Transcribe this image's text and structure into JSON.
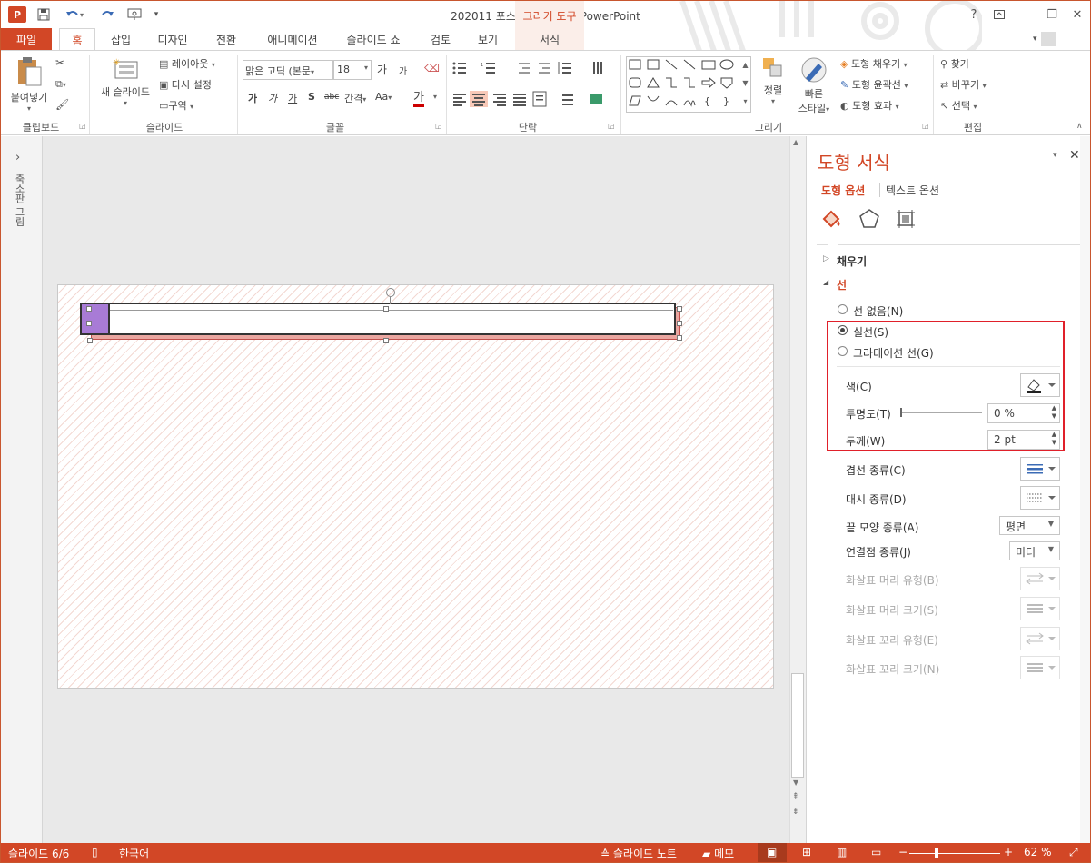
{
  "window": {
    "title": "202011 포스팅용 완성본 - PowerPoint",
    "contextual_group": "그리기 도구",
    "help": "?",
    "minimize": "—",
    "restore": "❐",
    "close": "✕"
  },
  "qat": {
    "logo": "P",
    "save_icon": "save-icon",
    "undo_icon": "undo-icon",
    "redo_icon": "redo-icon"
  },
  "tabs": [
    "파일",
    "홈",
    "삽입",
    "디자인",
    "전환",
    "애니메이션",
    "슬라이드 쇼",
    "검토",
    "보기",
    "서식"
  ],
  "ribbon": {
    "clipboard": {
      "paste": "붙여넣기",
      "label": "클립보드"
    },
    "slides": {
      "new_slide": "새 슬라이드",
      "layout": "레이아웃",
      "reset": "다시 설정",
      "section": "구역",
      "label": "슬라이드"
    },
    "font": {
      "font_name": "맑은 고딕 (본문",
      "font_size": "18",
      "label": "글꼴",
      "grow": "가",
      "shrink": "가",
      "bold": "가",
      "italic": "가",
      "underline": "가",
      "shadow": "S",
      "strike": "abc",
      "spacing": "간격",
      "case": "Aa",
      "color": "가"
    },
    "paragraph": {
      "label": "단락"
    },
    "drawing": {
      "arrange": "정렬",
      "quick_styles_1": "빠른",
      "quick_styles_2": "스타일",
      "fill": "도형 채우기",
      "outline": "도형 윤곽선",
      "effects": "도형 효과",
      "label": "그리기"
    },
    "editing": {
      "find": "찾기",
      "replace": "바꾸기",
      "select": "선택",
      "label": "편집"
    }
  },
  "thumb_panel": {
    "label": "축소판 그림",
    "expand": "›"
  },
  "pane": {
    "title": "도형 서식",
    "tab_shape": "도형 옵션",
    "tab_text": "텍스트 옵션",
    "fill_section": "채우기",
    "line_section": "선",
    "no_line": "선 없음(N)",
    "solid_line": "실선(S)",
    "gradient_line": "그라데이션 선(G)",
    "color": "색(C)",
    "transparency": "투명도(T)",
    "transparency_value": "0 %",
    "width": "두께(W)",
    "width_value": "2 pt",
    "compound": "겹선 종류(C)",
    "dash": "대시 종류(D)",
    "cap": "끝 모양 종류(A)",
    "cap_value": "평면",
    "join": "연결점 종류(J)",
    "join_value": "미터",
    "begin_arrow_type": "화살표 머리 유형(B)",
    "begin_arrow_size": "화살표 머리 크기(S)",
    "end_arrow_type": "화살표 꼬리 유형(E)",
    "end_arrow_size": "화살표 꼬리 크기(N)",
    "selected_line": "solid",
    "highlight_color": "#e0202a"
  },
  "status": {
    "slide": "슬라이드 6/6",
    "language": "한국어",
    "notes": "슬라이드 노트",
    "comments": "메모",
    "zoom": "62 %",
    "zoom_minus": "−",
    "zoom_plus": "+"
  },
  "colors": {
    "accent": "#d24726",
    "purple": "#a87bd6",
    "shadow_pink": "#eaa6a0"
  }
}
